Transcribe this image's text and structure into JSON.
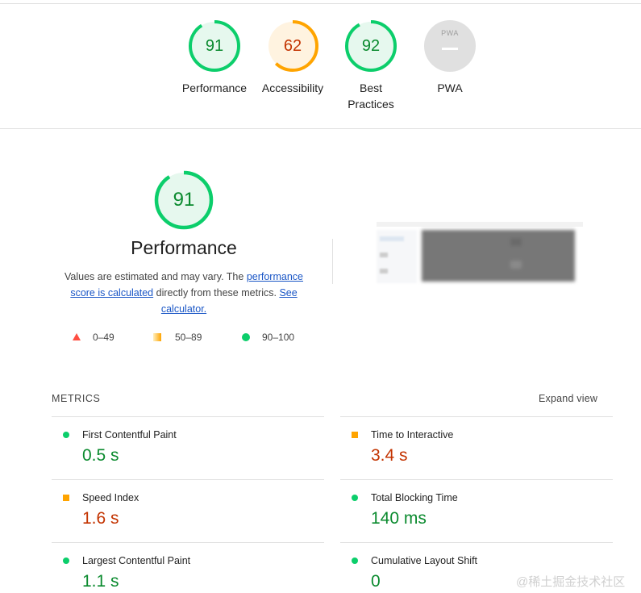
{
  "categories": [
    {
      "label": "Performance",
      "score": "91",
      "status": "pass"
    },
    {
      "label": "Accessibility",
      "score": "62",
      "status": "average"
    },
    {
      "label": "Best Practices",
      "score": "92",
      "status": "pass"
    },
    {
      "label": "PWA",
      "score": "PWA",
      "status": "na"
    }
  ],
  "score_fractions": [
    0.91,
    0.62,
    0.92
  ],
  "performance": {
    "score": "91",
    "title": "Performance",
    "desc_pre": "Values are estimated and may vary. The ",
    "link_score": "performance score is calculated",
    "desc_mid": " directly from these metrics. ",
    "link_calc": "See calculator."
  },
  "legend": [
    {
      "range": "0–49"
    },
    {
      "range": "50–89"
    },
    {
      "range": "90–100"
    }
  ],
  "metrics_section": {
    "heading": "METRICS",
    "expand": "Expand view"
  },
  "metrics": [
    {
      "name": "First Contentful Paint",
      "value": "0.5 s",
      "status": "good"
    },
    {
      "name": "Time to Interactive",
      "value": "3.4 s",
      "status": "average"
    },
    {
      "name": "Speed Index",
      "value": "1.6 s",
      "status": "average"
    },
    {
      "name": "Total Blocking Time",
      "value": "140 ms",
      "status": "good"
    },
    {
      "name": "Largest Contentful Paint",
      "value": "1.1 s",
      "status": "good"
    },
    {
      "name": "Cumulative Layout Shift",
      "value": "0",
      "status": "good"
    }
  ],
  "colors": {
    "pass": "#0cce6b",
    "pass_text": "#0a8a2e",
    "pass_fill": "#e6f8ee",
    "average": "#ffa400",
    "average_text": "#c33300",
    "average_fill": "#fff3e0",
    "fail": "#ff4e42",
    "na_fill": "#e0e0e0"
  },
  "watermark": "@稀土掘金技术社区"
}
